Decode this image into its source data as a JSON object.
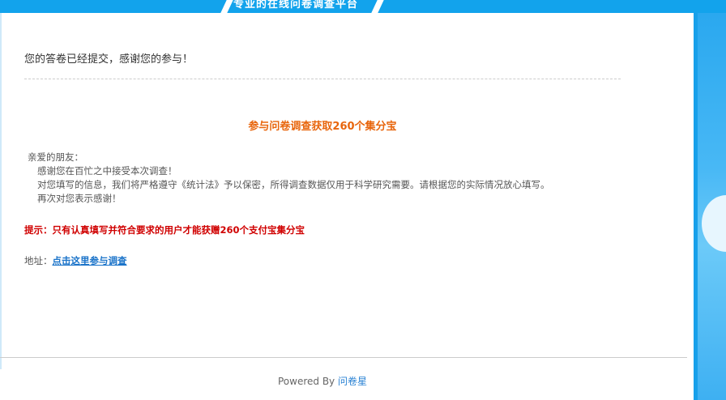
{
  "header": {
    "tagline": "专业的在线问卷调查平台"
  },
  "main": {
    "submitted_message": "您的答卷已经提交，感谢您的参与！",
    "promo_title": "参与问卷调查获取260个集分宝",
    "letter": {
      "greeting": "亲爱的朋友：",
      "lines": [
        "感谢您在百忙之中接受本次调查！",
        "对您填写的信息，我们将严格遵守《统计法》予以保密，所得调查数据仅用于科学研究需要。请根据您的实际情况放心填写。",
        "再次对您表示感谢！"
      ]
    },
    "tip": "提示：只有认真填写并符合要求的用户才能获赠260个支付宝集分宝",
    "address_label": "地址：",
    "address_link": "点击这里参与调查"
  },
  "footer": {
    "powered_by": "Powered By",
    "brand_link": "问卷星"
  },
  "colors": {
    "banner": "#12a3ec",
    "promo": "#e8650c",
    "tip": "#d00000",
    "link": "#1a73c9"
  }
}
